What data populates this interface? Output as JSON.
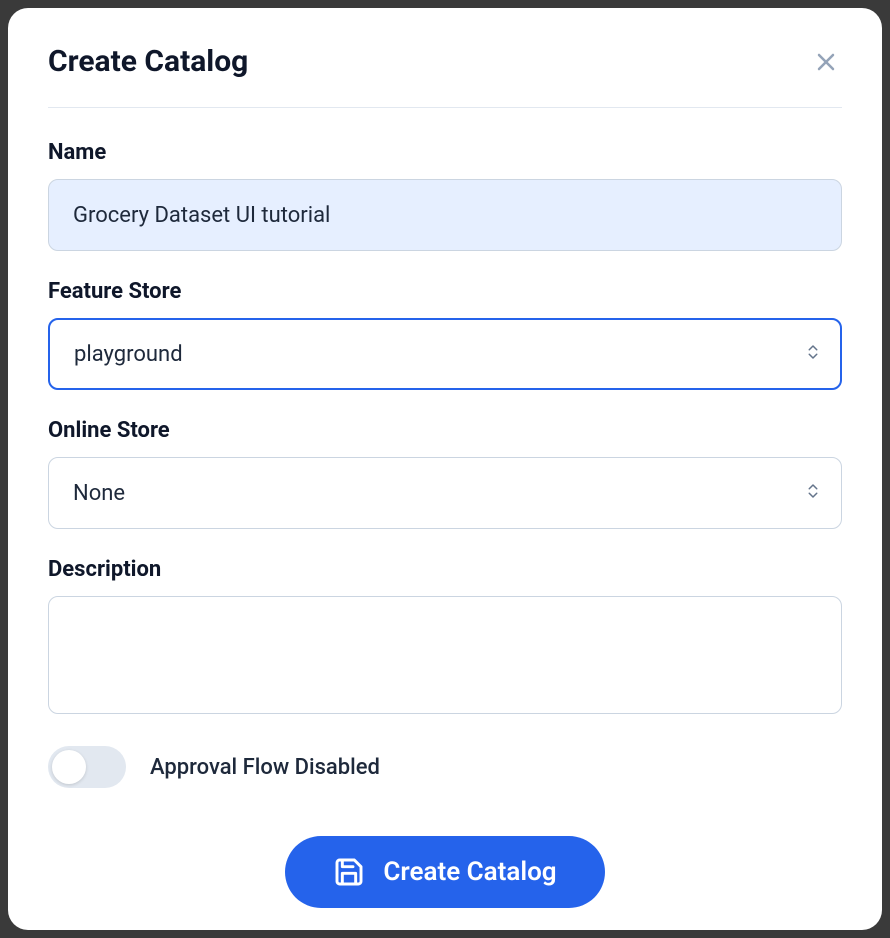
{
  "modal": {
    "title": "Create Catalog"
  },
  "form": {
    "name": {
      "label": "Name",
      "value": "Grocery Dataset UI tutorial"
    },
    "feature_store": {
      "label": "Feature Store",
      "value": "playground"
    },
    "online_store": {
      "label": "Online Store",
      "value": "None"
    },
    "description": {
      "label": "Description",
      "value": ""
    },
    "approval_toggle": {
      "label": "Approval Flow Disabled",
      "enabled": false
    }
  },
  "actions": {
    "submit_label": "Create Catalog"
  }
}
